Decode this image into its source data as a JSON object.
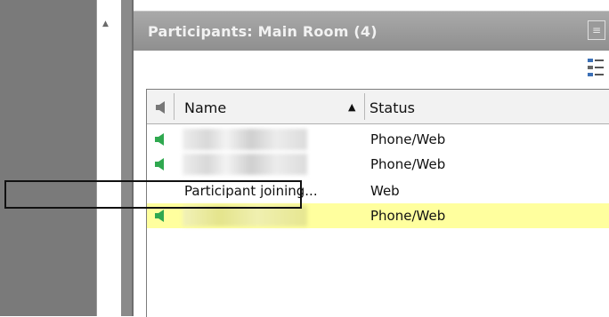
{
  "panel": {
    "title": "Participants: Main Room (4)",
    "title_button": "≡"
  },
  "scroll": {
    "up_arrow": "▲"
  },
  "list": {
    "columns": {
      "name": "Name",
      "sort_indicator": "▲",
      "status": "Status"
    },
    "rows": [
      {
        "name": "",
        "status": "Phone/Web",
        "speaker": true,
        "highlighted": false
      },
      {
        "name": "",
        "status": "Phone/Web",
        "speaker": true,
        "highlighted": false
      },
      {
        "name": "Participant joining...",
        "status": "Web",
        "speaker": false,
        "highlighted": false
      },
      {
        "name": "",
        "status": "Phone/Web",
        "speaker": true,
        "highlighted": true
      }
    ]
  },
  "colors": {
    "title_bar": "#9c9c9c",
    "highlight_row": "#ffff9e",
    "speaker_green": "#2fa84f"
  },
  "icons": [
    "speaker-icon",
    "list-options-icon",
    "scroll-up-icon"
  ]
}
